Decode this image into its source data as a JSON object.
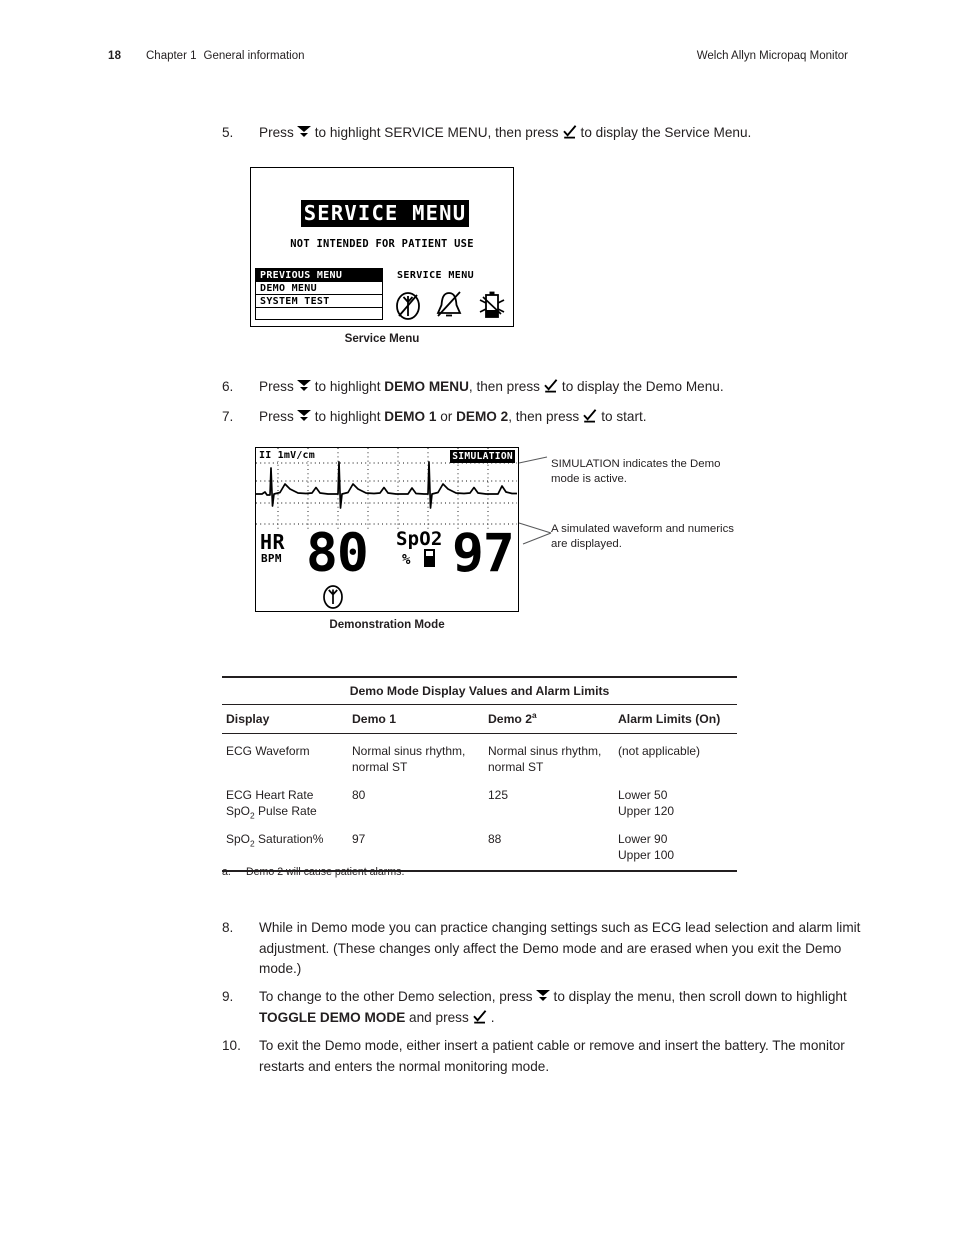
{
  "header": {
    "page_number": "18",
    "chapter": "Chapter 1",
    "chapter_title": "General information",
    "product": "Welch Allyn Micropaq Monitor"
  },
  "steps": {
    "s5": {
      "number": "5.",
      "t1": "Press",
      "t2": "to highlight SERVICE MENU, then press",
      "t3": "to display the Service Menu."
    },
    "s6": {
      "number": "6.",
      "t1": "Press",
      "t2": "to highlight",
      "b1": "DEMO MENU",
      "t3": ", then press",
      "t4": "to display the Demo Menu."
    },
    "s7": {
      "number": "7.",
      "t1": "Press",
      "t2": "to highlight",
      "b1": "DEMO 1",
      "t3": "or",
      "b2": "DEMO 2",
      "t4": ", then press",
      "t5": "to start."
    },
    "s8": {
      "number": "8.",
      "text": "While in Demo mode you can practice changing settings such as ECG lead selection and alarm limit adjustment. (These changes only affect the Demo mode and are erased when you exit the Demo mode.)"
    },
    "s9": {
      "number": "9.",
      "t1": "To change to the other Demo selection, press",
      "t2": "to display the menu, then scroll down to highlight",
      "b1": "TOGGLE DEMO MODE",
      "t3": "and press",
      "t4": "."
    },
    "s10": {
      "number": "10.",
      "text": "To exit the Demo mode, either insert a patient cable or remove and insert the battery. The monitor restarts and enters the normal monitoring mode."
    }
  },
  "service_menu_screen": {
    "caption": "Service Menu",
    "title": "SERVICE MENU",
    "subtitle": "NOT INTENDED FOR PATIENT USE",
    "menu_items": [
      {
        "label": "PREVIOUS MENU",
        "selected": true
      },
      {
        "label": "DEMO MENU",
        "selected": false
      },
      {
        "label": "SYSTEM TEST",
        "selected": false
      },
      {
        "label": "",
        "selected": false
      }
    ],
    "right_label": "SERVICE MENU",
    "status_icons": [
      "ecg-disabled-icon",
      "alarm-off-icon",
      "battery-icon"
    ]
  },
  "demo_screen": {
    "caption": "Demonstration Mode",
    "lead_label": "II  1mV/cm",
    "simulation_badge": "SIMULATION",
    "hr_label": "HR",
    "hr_units": "BPM",
    "hr_value": "80",
    "spo2_label": "SpO2",
    "spo2_units": "%",
    "spo2_value": "97",
    "pulse_icon": "ecg-pulse-icon"
  },
  "callouts": {
    "simulation": "SIMULATION indicates the Demo mode is active.",
    "waveform": "A simulated waveform and numerics are displayed."
  },
  "table": {
    "title": "Demo Mode Display Values and Alarm Limits",
    "columns": [
      "Display",
      "Demo 1",
      "Demo 2",
      "Alarm Limits (On)"
    ],
    "demo2_footnote_mark": "a",
    "rows": [
      {
        "display": "ECG Waveform",
        "demo1": "Normal sinus rhythm, normal ST",
        "demo2": "Normal sinus rhythm, normal ST",
        "limits": "(not applicable)"
      },
      {
        "display_pre": "ECG Heart Rate\nSpO",
        "display_sub": "2",
        "display_post": " Pulse Rate",
        "demo1": "80",
        "demo2": "125",
        "limits": "Lower 50\nUpper 120"
      },
      {
        "display_pre": "SpO",
        "display_sub": "2",
        "display_post": " Saturation%",
        "demo1": "97",
        "demo2": "88",
        "limits": "Lower 90\nUpper 100"
      }
    ]
  },
  "footnote": {
    "mark": "a.",
    "text": "Demo 2 will cause patient alarms."
  }
}
